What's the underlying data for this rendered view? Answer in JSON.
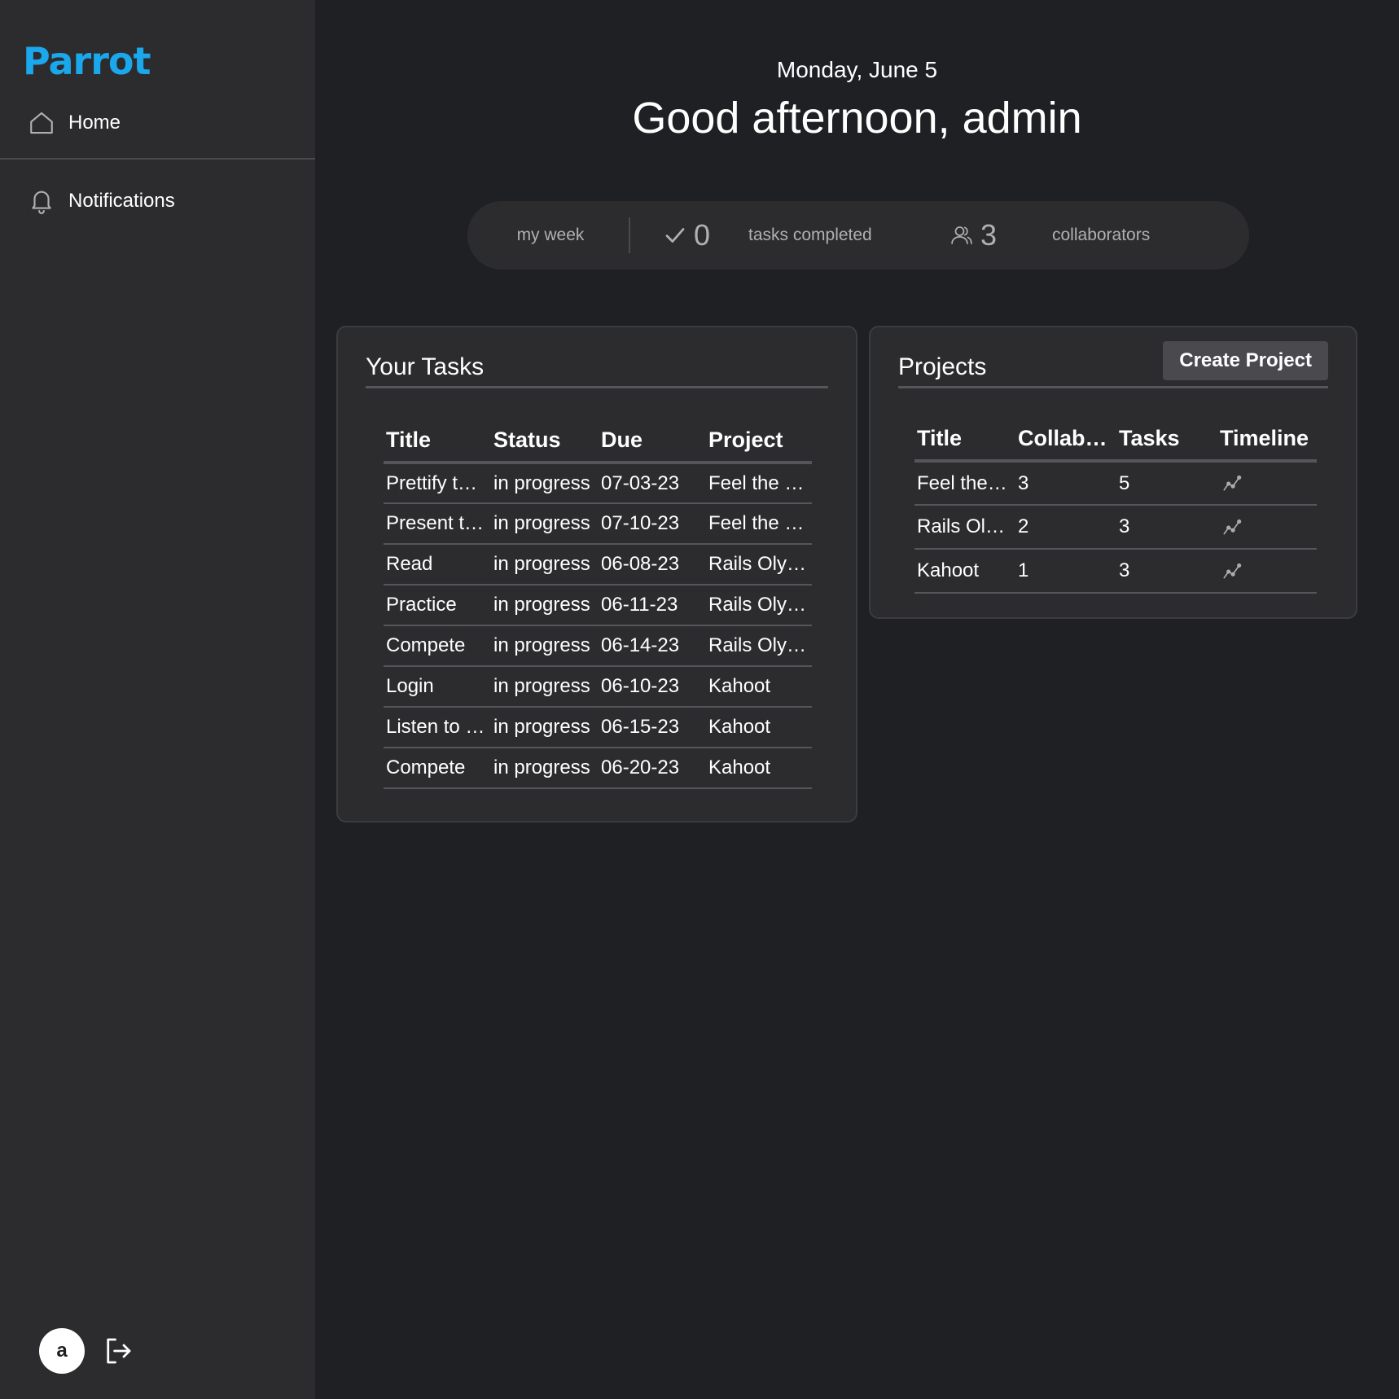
{
  "sidebar": {
    "logo_text": "Parrot",
    "logo_color": "#1aa7ec",
    "nav": [
      {
        "label": "Home",
        "icon": "home-icon"
      },
      {
        "label": "Notifications",
        "icon": "bell-icon"
      }
    ],
    "avatar_initial": "a",
    "logout_icon": "logout-icon"
  },
  "header": {
    "date": "Monday, June 5",
    "greeting": "Good afternoon, admin"
  },
  "stats": {
    "period": "my week",
    "tasks_completed_count": "0",
    "tasks_completed_label": "tasks completed",
    "collaborators_count": "3",
    "collaborators_label": "collaborators"
  },
  "tasks": {
    "title": "Your Tasks",
    "columns": [
      "Title",
      "Status",
      "Due",
      "Project"
    ],
    "rows": [
      [
        "Prettify t…",
        "in progress",
        "07-03-23",
        "Feel the …"
      ],
      [
        "Present t…",
        "in progress",
        "07-10-23",
        "Feel the …"
      ],
      [
        "Read",
        "in progress",
        "06-08-23",
        "Rails Oly…"
      ],
      [
        "Practice",
        "in progress",
        "06-11-23",
        "Rails Oly…"
      ],
      [
        "Compete",
        "in progress",
        "06-14-23",
        "Rails Oly…"
      ],
      [
        "Login",
        "in progress",
        "06-10-23",
        "Kahoot"
      ],
      [
        "Listen to …",
        "in progress",
        "06-15-23",
        "Kahoot"
      ],
      [
        "Compete",
        "in progress",
        "06-20-23",
        "Kahoot"
      ]
    ]
  },
  "projects": {
    "title": "Projects",
    "create_label": "Create Project",
    "columns": [
      "Title",
      "Collab…",
      "Tasks",
      "Timeline"
    ],
    "rows": [
      [
        "Feel the…",
        "3",
        "5"
      ],
      [
        "Rails Ol…",
        "2",
        "3"
      ],
      [
        "Kahoot",
        "1",
        "3"
      ]
    ],
    "timeline_icon": "line-chart-icon"
  }
}
